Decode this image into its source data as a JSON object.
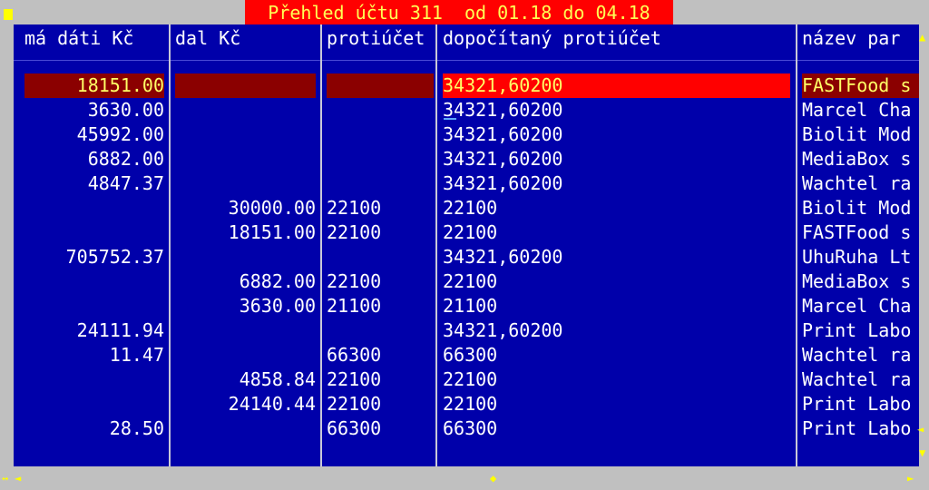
{
  "title": "Přehled účtu 311  od 01.18 do 04.18",
  "columns": [
    "má dáti Kč",
    "dal Kč",
    "protiúčet",
    "dopočítaný protiúčet",
    "název par"
  ],
  "rows": [
    [
      "18151.00",
      "",
      "",
      "34321,60200",
      "FASTFood s"
    ],
    [
      "3630.00",
      "",
      "",
      "34321,60200",
      "Marcel Cha"
    ],
    [
      "45992.00",
      "",
      "",
      "34321,60200",
      "Biolit Mod"
    ],
    [
      "6882.00",
      "",
      "",
      "34321,60200",
      "MediaBox s"
    ],
    [
      "4847.37",
      "",
      "",
      "34321,60200",
      "Wachtel ra"
    ],
    [
      "",
      "30000.00",
      "22100",
      "22100",
      "Biolit Mod"
    ],
    [
      "",
      "18151.00",
      "22100",
      "22100",
      "FASTFood s"
    ],
    [
      "705752.37",
      "",
      "",
      "34321,60200",
      "UhuRuha Lt"
    ],
    [
      "",
      "6882.00",
      "22100",
      "22100",
      "MediaBox s"
    ],
    [
      "",
      "3630.00",
      "21100",
      "21100",
      "Marcel Cha"
    ],
    [
      "24111.94",
      "",
      "",
      "34321,60200",
      "Print Labo"
    ],
    [
      "11.47",
      "",
      "66300",
      "66300",
      "Wachtel ra"
    ],
    [
      "",
      "4858.84",
      "22100",
      "22100",
      "Wachtel ra"
    ],
    [
      "",
      "24140.44",
      "22100",
      "22100",
      "Print Labo"
    ],
    [
      "28.50",
      "",
      "66300",
      "66300",
      "Print Labo"
    ]
  ],
  "scroll": {
    "up": "▲",
    "down": "▼",
    "thumb": "◄",
    "left": "◄",
    "right": "►",
    "hthumb": "◆",
    "resize": "↔"
  }
}
